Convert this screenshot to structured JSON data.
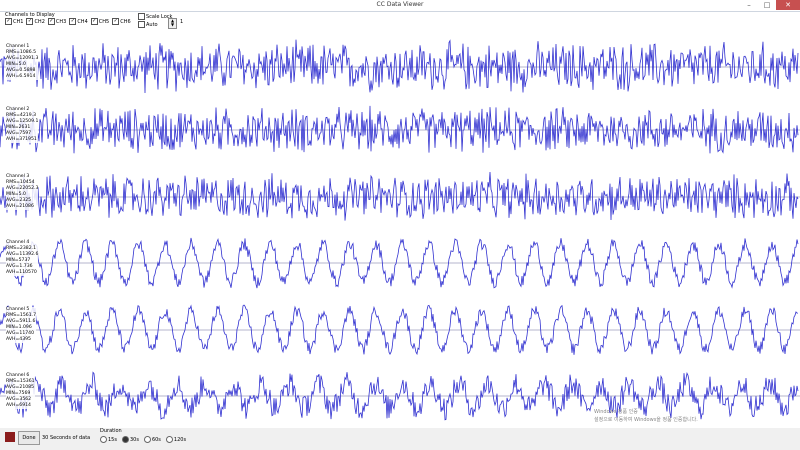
{
  "window": {
    "title": "CC Data Viewer"
  },
  "channels_group": {
    "label": "Channels to Display",
    "items": [
      {
        "label": "CH1",
        "checked": true
      },
      {
        "label": "CH2",
        "checked": true
      },
      {
        "label": "CH3",
        "checked": true
      },
      {
        "label": "CH4",
        "checked": true
      },
      {
        "label": "CH5",
        "checked": true
      },
      {
        "label": "CH6",
        "checked": true
      }
    ]
  },
  "options": {
    "scale_lock": "Scale Lock",
    "auto": "Auto",
    "spin_value": "1"
  },
  "channels": [
    {
      "name": "Channel 1",
      "stats": [
        "RMS=1086.5",
        "AVG=12091.3",
        "MIN=5.0",
        "AVG=0.5898",
        "AVH=6.5914"
      ],
      "kind": "noise",
      "color": "#3030d0"
    },
    {
      "name": "Channel 2",
      "stats": [
        "RMS=4219.3",
        "AVG=12509.1",
        "MIN=2631",
        "AVG=7597",
        "AVH=371951"
      ],
      "kind": "noise",
      "color": "#3030d0"
    },
    {
      "name": "Channel 3",
      "stats": [
        "RMS=10454",
        "AVG=22052.3",
        "MIN=5.0",
        "AVG=2325",
        "AVH=21086"
      ],
      "kind": "noise",
      "color": "#3030d0"
    },
    {
      "name": "Channel 4",
      "stats": [
        "RMS=2382.1",
        "AVG=11392.6",
        "MIN=5737",
        "AVG=1.736",
        "AVH=110570"
      ],
      "kind": "wave",
      "color": "#3030d0"
    },
    {
      "name": "Channel 5",
      "stats": [
        "RMS=1561.7",
        "AVG=5911.6",
        "MIN=1.096",
        "AVG=11740",
        "AVH=4395"
      ],
      "kind": "wave",
      "color": "#3030d0"
    },
    {
      "name": "Channel 6",
      "stats": [
        "RMS=15361",
        "AVG=21085",
        "MIN=7569",
        "AVG=3562",
        "AVH=6914"
      ],
      "kind": "mixed",
      "color": "#3030d0"
    }
  ],
  "bottom": {
    "done": "Done",
    "seconds": "30 Seconds of data",
    "duration_label": "Duration",
    "durations": [
      {
        "label": "15s",
        "selected": false
      },
      {
        "label": "30s",
        "selected": true
      },
      {
        "label": "60s",
        "selected": false
      },
      {
        "label": "120s",
        "selected": false
      }
    ]
  },
  "watermark": [
    "Windows 정품 인증",
    "설정으로 이동하여 Windows을 정품 인증합니다."
  ]
}
